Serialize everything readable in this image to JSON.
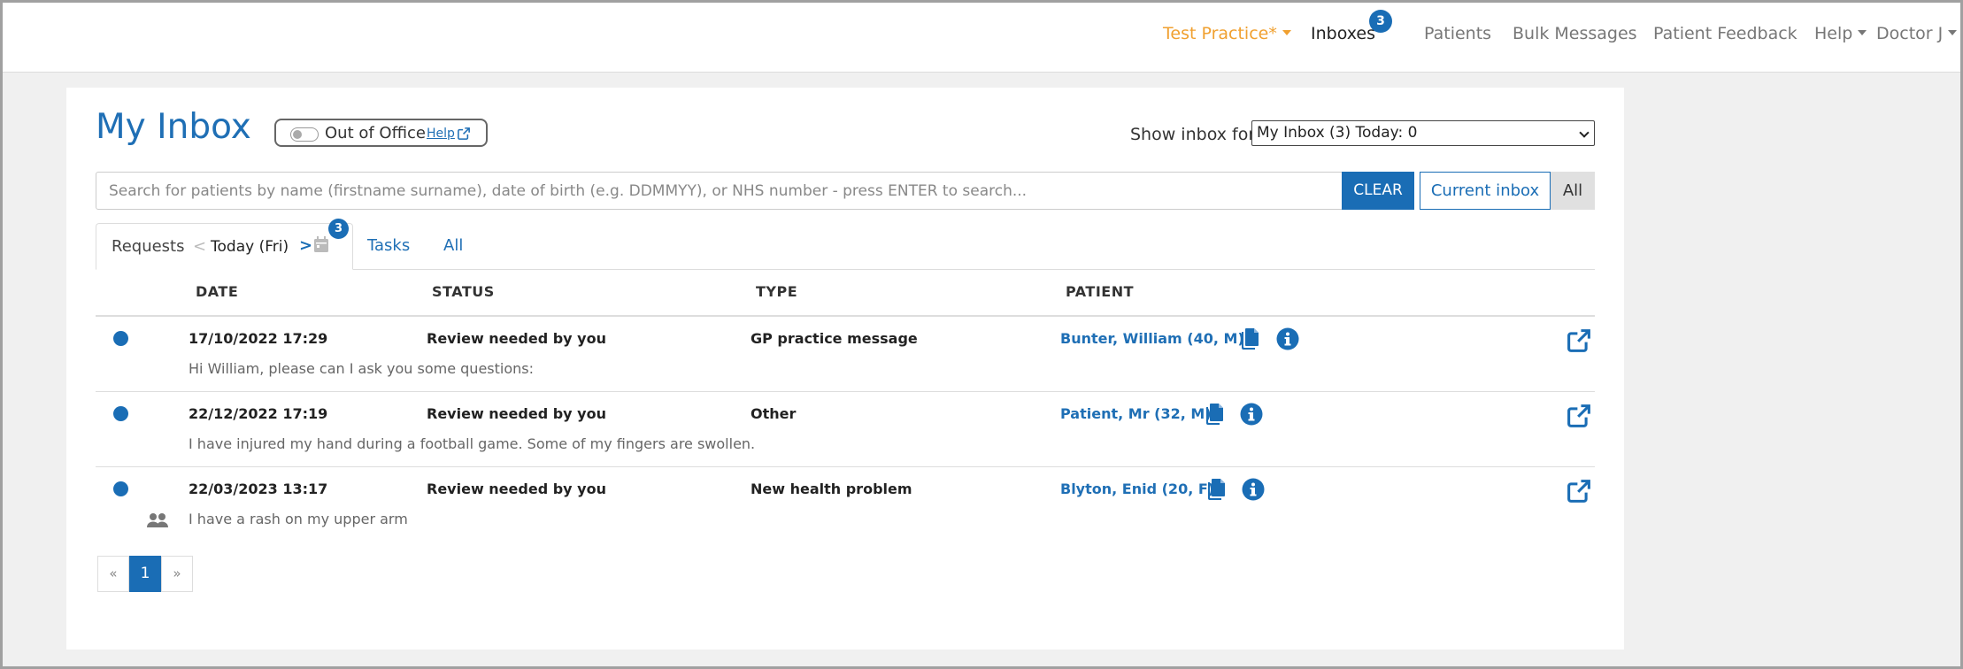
{
  "nav": {
    "practice": "Test Practice*",
    "inboxes": "Inboxes",
    "inboxes_badge": "3",
    "patients": "Patients",
    "bulk_messages": "Bulk Messages",
    "patient_feedback": "Patient Feedback",
    "help": "Help",
    "user": "Doctor J"
  },
  "page": {
    "title": "My Inbox",
    "out_of_office": "Out of Office",
    "help_link": "Help",
    "show_inbox_label": "Show inbox for",
    "show_inbox_value": "My Inbox (3) Today: 0"
  },
  "search": {
    "placeholder": "Search for patients by name (firstname surname), date of birth (e.g. DDMMYY), or NHS number - press ENTER to search...",
    "clear": "CLEAR",
    "current_inbox": "Current inbox",
    "all": "All"
  },
  "tabs": {
    "requests": "Requests",
    "prev": "<",
    "day": "Today (Fri)",
    "next": ">",
    "badge": "3",
    "tasks": "Tasks",
    "all": "All"
  },
  "table": {
    "headers": {
      "date": "DATE",
      "status": "STATUS",
      "type": "TYPE",
      "patient": "PATIENT"
    },
    "rows": [
      {
        "date": "17/10/2022 17:29",
        "status": "Review needed by you",
        "type": "GP practice message",
        "patient": "Bunter, William (40, M)",
        "message": "Hi William, please can I ask you some questions:"
      },
      {
        "date": "22/12/2022 17:19",
        "status": "Review needed by you",
        "type": "Other",
        "patient": "Patient, Mr (32, M)",
        "message": "I have injured my hand during a football game. Some of my fingers are swollen."
      },
      {
        "date": "22/03/2023 13:17",
        "status": "Review needed by you",
        "type": "New health problem",
        "patient": "Blyton, Enid (20, F)",
        "message": "I have a rash on my upper arm"
      }
    ]
  },
  "pagination": {
    "prev": "«",
    "current": "1",
    "next": "»"
  },
  "colors": {
    "primary": "#1a6db5",
    "practice": "#f0a030",
    "background": "#f0f0f0"
  },
  "icons": [
    "toggle-switch-icon",
    "external-link-icon",
    "calendar-icon",
    "copy-document-icon",
    "info-circle-icon",
    "people-icon",
    "unread-dot-icon"
  ]
}
